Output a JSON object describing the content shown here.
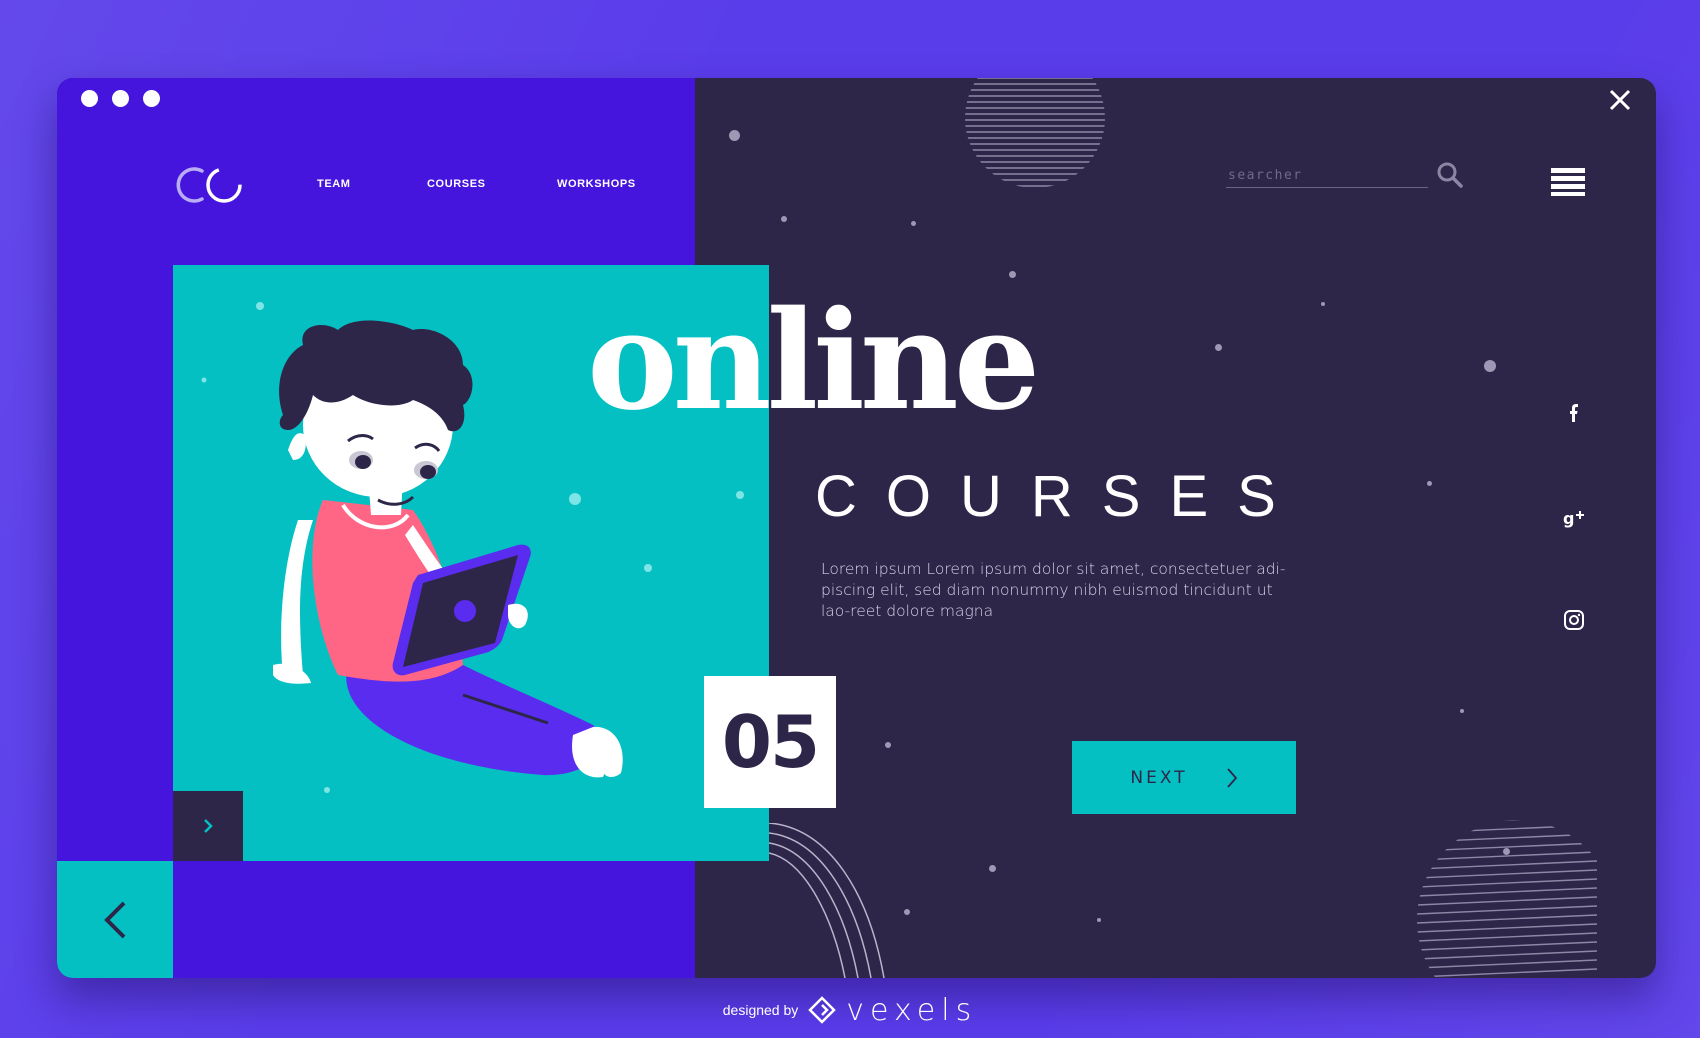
{
  "window": {
    "controls": [
      "dot",
      "dot",
      "dot"
    ],
    "close_icon": "close-icon"
  },
  "nav": {
    "items": [
      {
        "label": "TEAM"
      },
      {
        "label": "COURSES"
      },
      {
        "label": "WORKSHOPS"
      }
    ]
  },
  "search": {
    "placeholder": "searcher",
    "icon": "search-icon"
  },
  "menu": {
    "icon": "hamburger-menu-icon"
  },
  "hero": {
    "headline": "online",
    "subhead": "COURSES",
    "body": "Lorem ipsum Lorem ipsum dolor sit amet, consectetuer adi-piscing elit, sed diam nonummy nibh euismod tincidunt ut lao-reet dolore magna",
    "slide_number": "05",
    "next_label": "NEXT"
  },
  "social": [
    {
      "name": "facebook-icon"
    },
    {
      "name": "google-plus-icon"
    },
    {
      "name": "instagram-icon"
    }
  ],
  "footer": {
    "designed_by": "designed by",
    "brand": "vexels"
  },
  "colors": {
    "background": "#5a3dea",
    "left_panel": "#4514dd",
    "dark_panel": "#2e2648",
    "teal": "#05c0c3",
    "white": "#ffffff"
  }
}
